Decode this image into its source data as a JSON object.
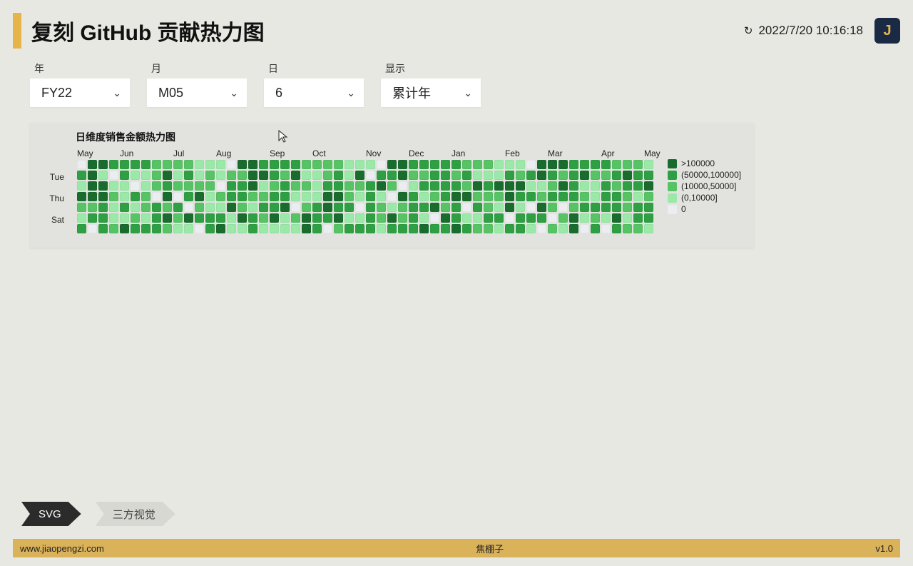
{
  "header": {
    "title": "复刻 GitHub 贡献热力图",
    "timestamp": "2022/7/20 10:16:18",
    "refresh_icon": "↻",
    "logo_letter": "J"
  },
  "filters": [
    {
      "label": "年",
      "value": "FY22"
    },
    {
      "label": "月",
      "value": "M05"
    },
    {
      "label": "日",
      "value": "6"
    },
    {
      "label": "显示",
      "value": "累计年"
    }
  ],
  "chart_data": {
    "type": "heatmap",
    "title": "日维度销售金额热力图",
    "day_labels": [
      "",
      "Tue",
      "",
      "Thu",
      "",
      "Sat",
      ""
    ],
    "months": [
      "May",
      "Jun",
      "Jul",
      "Aug",
      "Sep",
      "Oct",
      "Nov",
      "Dec",
      "Jan",
      "Feb",
      "Mar",
      "Apr",
      "May"
    ],
    "legend": [
      {
        "label": ">100000",
        "color": "#196c2e"
      },
      {
        "label": "(50000,100000]",
        "color": "#2ea043"
      },
      {
        "label": "(10000,50000]",
        "color": "#56c364"
      },
      {
        "label": "(0,10000]",
        "color": "#9be9a8"
      },
      {
        "label": "0",
        "color": "#ebedf0"
      }
    ],
    "weeks": 54,
    "rows": 7,
    "colors": [
      "#ebedf0",
      "#9be9a8",
      "#56c364",
      "#2ea043",
      "#196c2e"
    ]
  },
  "tabs": [
    {
      "label": "SVG",
      "active": true
    },
    {
      "label": "三方视觉",
      "active": false
    }
  ],
  "footer": {
    "left": "www.jiaopengzi.com",
    "center": "焦棚子",
    "right": "v1.0"
  }
}
